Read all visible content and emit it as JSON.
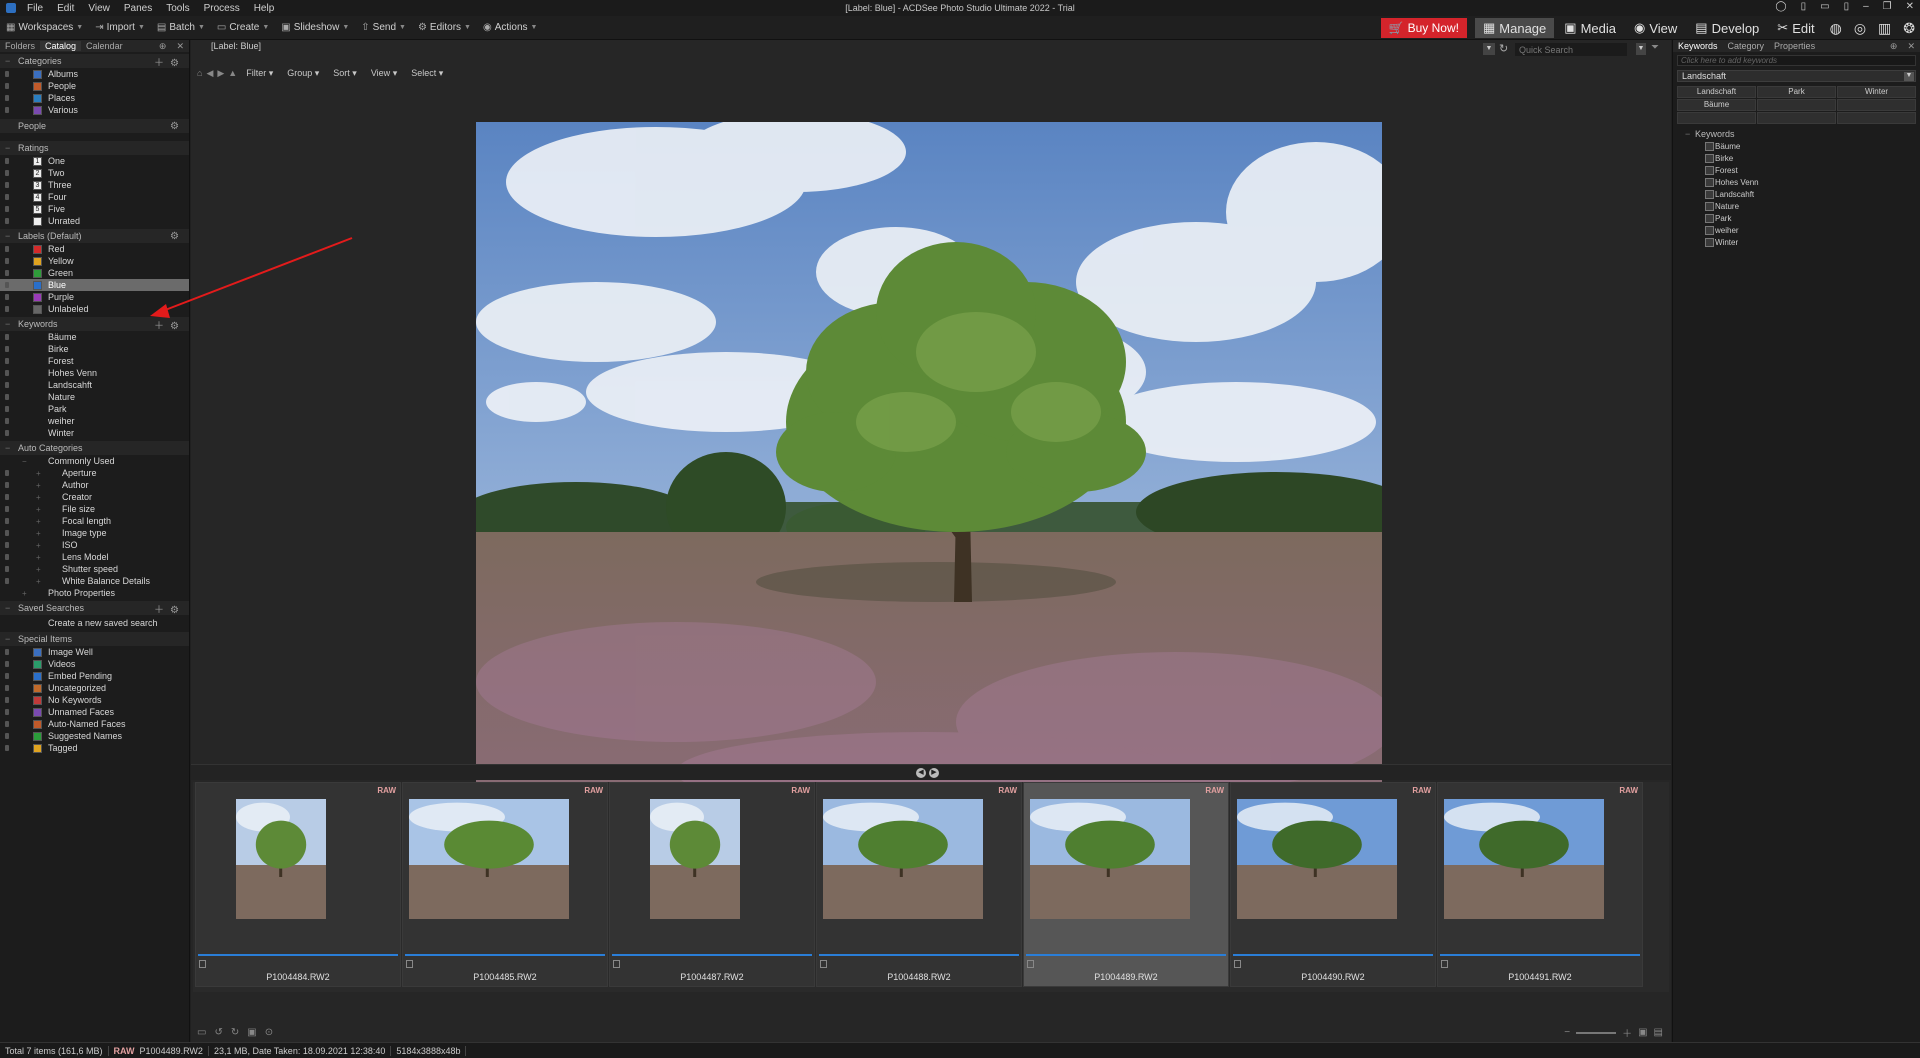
{
  "window": {
    "title": "[Label: Blue] - ACDSee Photo Studio Ultimate 2022 - Trial",
    "menu": [
      "File",
      "Edit",
      "View",
      "Panes",
      "Tools",
      "Process",
      "Help"
    ]
  },
  "toolbar": {
    "workspaces": "Workspaces",
    "import": "Import",
    "batch": "Batch",
    "create": "Create",
    "slideshow": "Slideshow",
    "send": "Send",
    "editors": "Editors",
    "actions": "Actions"
  },
  "modes": {
    "buy_now": "Buy Now!",
    "manage": "Manage",
    "media": "Media",
    "view": "View",
    "develop": "Develop",
    "edit": "Edit"
  },
  "left_panel": {
    "tabs": [
      "Folders",
      "Catalog",
      "Calendar"
    ],
    "categories_header": "Categories",
    "categories": [
      "Albums",
      "People",
      "Places",
      "Various"
    ],
    "people_header": "People",
    "ratings_header": "Ratings",
    "ratings": [
      {
        "num": "1",
        "label": "One"
      },
      {
        "num": "2",
        "label": "Two"
      },
      {
        "num": "3",
        "label": "Three"
      },
      {
        "num": "4",
        "label": "Four"
      },
      {
        "num": "5",
        "label": "Five"
      },
      {
        "num": "",
        "label": "Unrated"
      }
    ],
    "labels_header": "Labels (Default)",
    "labels": [
      {
        "label": "Red",
        "color": "#d42a2a"
      },
      {
        "label": "Yellow",
        "color": "#e0a320"
      },
      {
        "label": "Green",
        "color": "#2f9c3a"
      },
      {
        "label": "Blue",
        "color": "#2a6fc9"
      },
      {
        "label": "Purple",
        "color": "#9a3bb8"
      },
      {
        "label": "Unlabeled",
        "color": "#666666"
      }
    ],
    "keywords_header": "Keywords",
    "keywords": [
      "Bäume",
      "Birke",
      "Forest",
      "Hohes Venn",
      "Landscahft",
      "Nature",
      "Park",
      "weiher",
      "Winter"
    ],
    "auto_categories_header": "Auto Categories",
    "commonly_used": "Commonly Used",
    "auto_items": [
      "Aperture",
      "Author",
      "Creator",
      "File size",
      "Focal length",
      "Image type",
      "ISO",
      "Lens Model",
      "Shutter speed",
      "White Balance Details"
    ],
    "photo_properties": "Photo Properties",
    "saved_searches_header": "Saved Searches",
    "saved_searches_action": "Create a new saved search",
    "special_items_header": "Special Items",
    "special_items": [
      "Image Well",
      "Videos",
      "Embed Pending",
      "Uncategorized",
      "No Keywords",
      "Unnamed Faces",
      "Auto-Named Faces",
      "Suggested Names",
      "Tagged"
    ]
  },
  "center": {
    "breadcrumb": "[Label: Blue]",
    "quick_search_placeholder": "Quick Search",
    "nav_menus": [
      "Filter",
      "Group",
      "Sort",
      "View",
      "Select"
    ]
  },
  "filmstrip": [
    {
      "name": "P1004484.RW2",
      "tag": "RAW"
    },
    {
      "name": "P1004485.RW2",
      "tag": "RAW"
    },
    {
      "name": "P1004487.RW2",
      "tag": "RAW"
    },
    {
      "name": "P1004488.RW2",
      "tag": "RAW"
    },
    {
      "name": "P1004489.RW2",
      "tag": "RAW",
      "selected": true
    },
    {
      "name": "P1004490.RW2",
      "tag": "RAW"
    },
    {
      "name": "P1004491.RW2",
      "tag": "RAW"
    }
  ],
  "right_panel": {
    "tabs": [
      "Keywords",
      "Category",
      "Properties"
    ],
    "input_placeholder": "Click here to add keywords",
    "selected_set": "Landschaft",
    "quick_keywords": [
      "Landschaft",
      "Park",
      "Winter",
      "Bäume",
      "",
      "",
      "",
      "",
      ""
    ],
    "tree_header": "Keywords",
    "keywords": [
      "Bäume",
      "Birke",
      "Forest",
      "Hohes Venn",
      "Landscahft",
      "Nature",
      "Park",
      "weiher",
      "Winter"
    ]
  },
  "status": {
    "total": "Total 7 items  (161,6 MB)",
    "raw": "RAW",
    "file": "P1004489.RW2",
    "info": "23,1 MB, Date Taken: 18.09.2021 12:38:40",
    "dims": "5184x3888x48b"
  },
  "colors": {
    "accent": "#2a7ed8",
    "buy_now": "#d4242b",
    "raw_tag": "#e2a0a0"
  }
}
